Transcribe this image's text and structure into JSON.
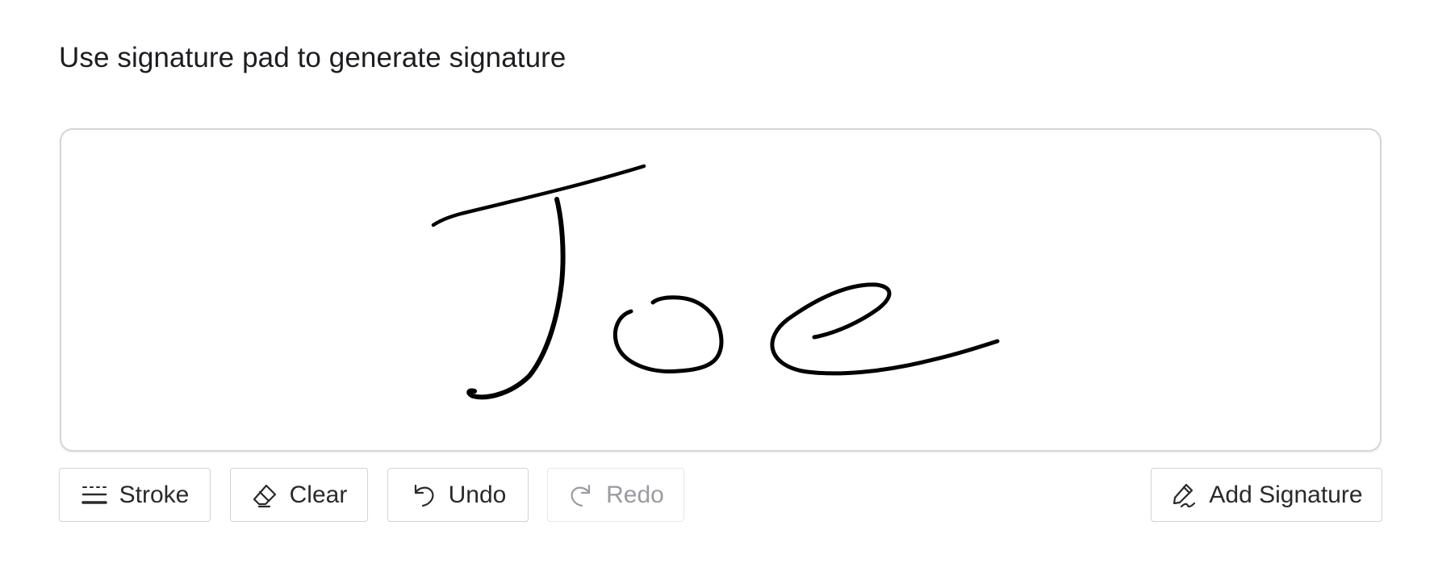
{
  "page": {
    "heading": "Use signature pad to generate signature"
  },
  "signature_pad": {
    "ink_color": "#000000",
    "border_color": "#d6d6da"
  },
  "toolbar": {
    "stroke": {
      "label": "Stroke",
      "icon": "stroke-lines-icon",
      "disabled": false
    },
    "clear": {
      "label": "Clear",
      "icon": "eraser-icon",
      "disabled": false
    },
    "undo": {
      "label": "Undo",
      "icon": "undo-icon",
      "disabled": false
    },
    "redo": {
      "label": "Redo",
      "icon": "redo-icon",
      "disabled": true
    },
    "add_signature": {
      "label": "Add Signature",
      "icon": "signature-pen-icon",
      "disabled": false
    }
  }
}
